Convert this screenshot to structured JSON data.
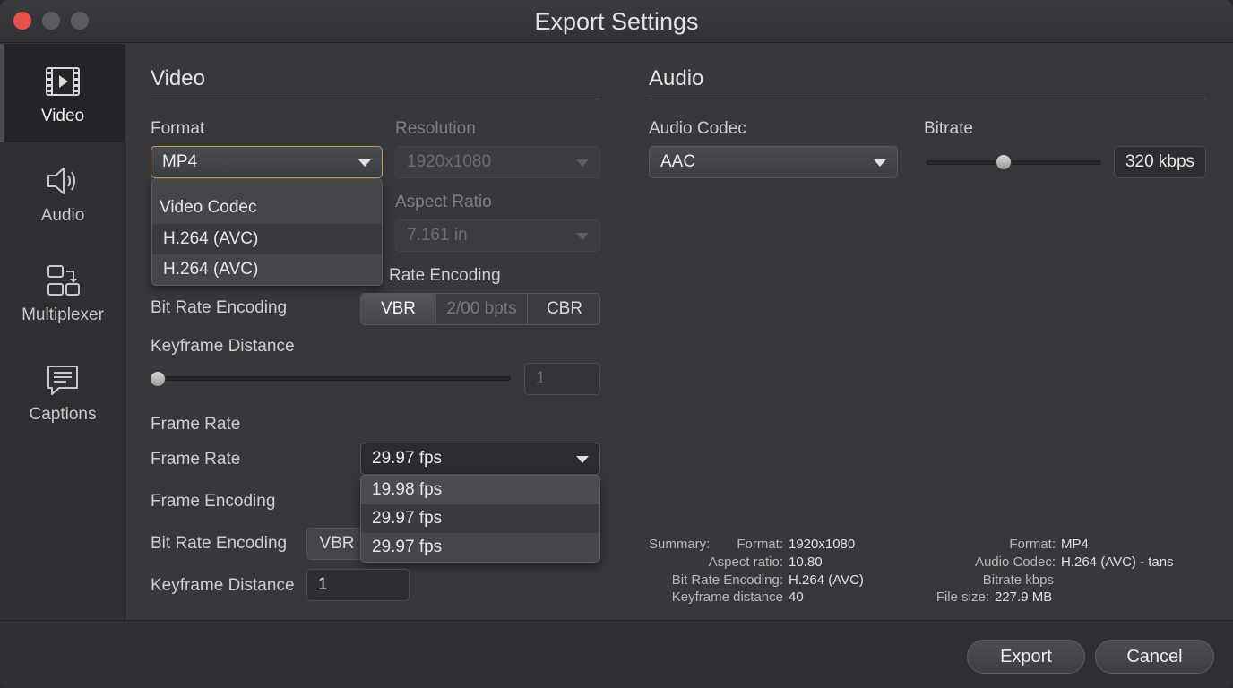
{
  "window": {
    "title": "Export Settings"
  },
  "sidebar": {
    "items": [
      {
        "label": "Video",
        "icon": "film-icon",
        "active": true
      },
      {
        "label": "Audio",
        "icon": "speaker-icon",
        "active": false
      },
      {
        "label": "Multiplexer",
        "icon": "multiplexer-icon",
        "active": false
      },
      {
        "label": "Captions",
        "icon": "captions-icon",
        "active": false
      }
    ]
  },
  "video": {
    "title": "Video",
    "format_label": "Format",
    "format_value": "MP4",
    "resolution_label": "Resolution",
    "resolution_value": "1920x1080",
    "format_dropdown": {
      "header": "Video Codec",
      "options": [
        "H.264 (AVC)",
        "H.264 (AVC)"
      ]
    },
    "aspect_label": "Aspect Ratio",
    "aspect_value": "7.161 in",
    "rate_encoding_label": "Rate Encoding",
    "bitrate_encoding_label": "Bit Rate Encoding",
    "bitrate_segments": [
      "VBR",
      "2/00 bpts",
      "CBR"
    ],
    "keyframe_label": "Keyframe Distance",
    "keyframe_value": "1",
    "keyframe_slider_level": 0,
    "frame_rate_group": "Frame Rate",
    "frame_rate_label": "Frame Rate",
    "frame_rate_value": "29.97 fps",
    "frame_rate_options": [
      "19.98 fps",
      "29.97 fps",
      "29.97 fps"
    ],
    "frame_encoding_label": "Frame Encoding",
    "bitrate_encoding2_label": "Bit Rate Encoding",
    "bitrate_encoding2_value": "VBR",
    "keyframe2_label": "Keyframe Distance",
    "keyframe2_value": "1"
  },
  "audio": {
    "title": "Audio",
    "codec_label": "Audio Codec",
    "codec_value": "AAC",
    "bitrate_label": "Bitrate",
    "bitrate_value": "320 kbps",
    "bitrate_slider_level": 0.44
  },
  "summary": {
    "heading": "Summary:",
    "left": [
      {
        "k": "Format:",
        "v": "1920x1080"
      },
      {
        "k": "Aspect ratio:",
        "v": "10.80"
      },
      {
        "k": "Bit Rate Encoding:",
        "v": "H.264 (AVC)"
      },
      {
        "k": "Keyframe distance",
        "v": "40"
      }
    ],
    "right": [
      {
        "k": "Format:",
        "v": "MP4"
      },
      {
        "k": "Audio Codec:",
        "v": "H.264 (AVC) - tans"
      },
      {
        "k": "Bitrate kbps",
        "v": ""
      },
      {
        "k": "File size:",
        "v": "227.9 MB"
      }
    ]
  },
  "footer": {
    "export_label": "Export",
    "cancel_label": "Cancel"
  },
  "colors": {
    "close": "#e5514b",
    "focus": "#c89a4a",
    "background": "#37383c"
  }
}
